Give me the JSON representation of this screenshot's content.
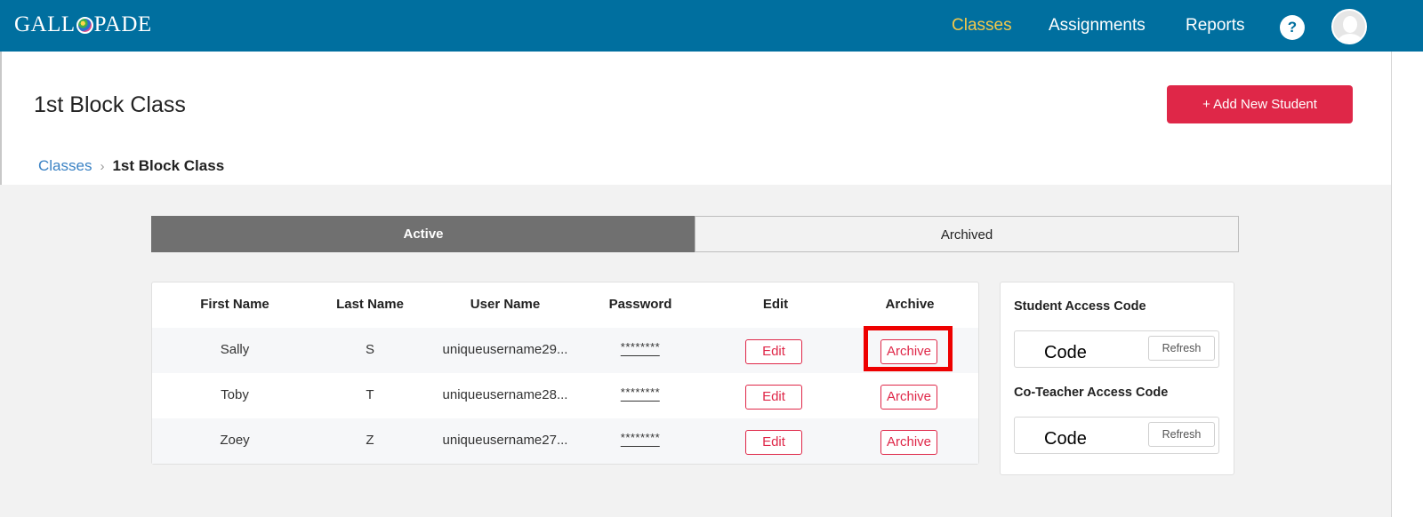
{
  "app": {
    "logo_text_left": "GALL",
    "logo_text_right": "PADE",
    "brand_color": "#006f9f",
    "accent_color": "#df2748"
  },
  "nav": {
    "items": [
      {
        "label": "Classes",
        "active": true
      },
      {
        "label": "Assignments",
        "active": false
      },
      {
        "label": "Reports",
        "active": false
      }
    ],
    "help_label": "?",
    "help_icon": "help-icon",
    "avatar_icon": "user-avatar-icon"
  },
  "header": {
    "title": "1st Block Class",
    "add_button_label": "+ Add New Student"
  },
  "breadcrumb": {
    "link": "Classes",
    "separator": "›",
    "current": "1st Block Class"
  },
  "tabs": [
    {
      "label": "Active",
      "selected": true
    },
    {
      "label": "Archived",
      "selected": false
    }
  ],
  "table": {
    "columns": [
      "First Name",
      "Last Name",
      "User Name",
      "Password",
      "Edit",
      "Archive"
    ],
    "rows": [
      {
        "first": "Sally",
        "last": "S",
        "username": "uniqueusername29...",
        "password": "********",
        "edit": "Edit",
        "archive": "Archive"
      },
      {
        "first": "Toby",
        "last": "T",
        "username": "uniqueusername28...",
        "password": "********",
        "edit": "Edit",
        "archive": "Archive"
      },
      {
        "first": "Zoey",
        "last": "Z",
        "username": "uniqueusername27...",
        "password": "********",
        "edit": "Edit",
        "archive": "Archive"
      }
    ],
    "highlighted_row": 0,
    "highlight_color": "#ee0000"
  },
  "access": {
    "student_label": "Student Access Code",
    "student_code": "Code",
    "coteacher_label": "Co-Teacher Access Code",
    "coteacher_code": "Code",
    "refresh_label": "Refresh"
  }
}
